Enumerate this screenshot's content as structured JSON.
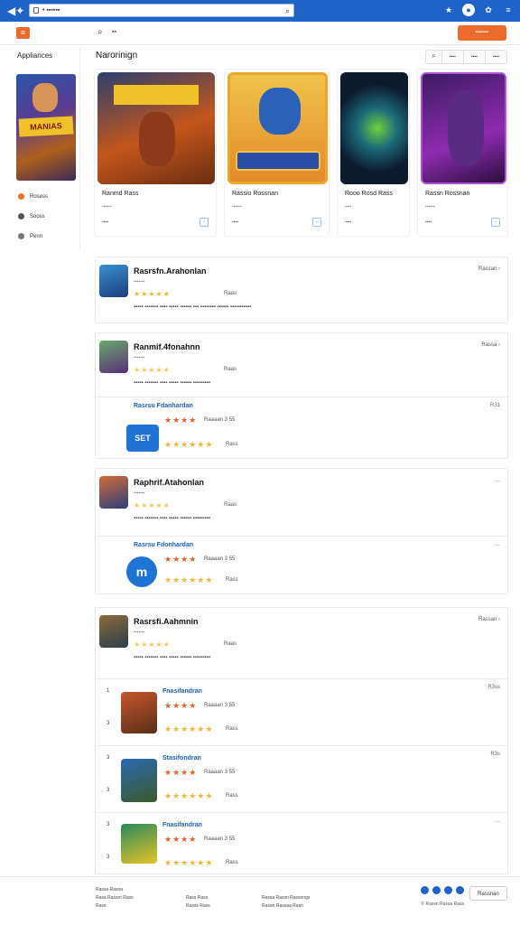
{
  "browser": {
    "address": "• ▪▪▪▪▪▪"
  },
  "toolbar": {
    "search_text": "▪▪",
    "cta_label": "▪▪▪▪▪▪▪"
  },
  "sidebar": {
    "title": "Appliances",
    "banner_text": "MANIAS",
    "items": [
      {
        "label": "Rosess"
      },
      {
        "label": "Sooss"
      },
      {
        "label": "Penn"
      }
    ]
  },
  "main": {
    "heading": "Narorinign",
    "filters": [
      "⌕",
      "▪▪▪▪",
      "▪▪▪▪",
      "▪▪▪▪"
    ]
  },
  "featured": [
    {
      "name": "Ranmd Rass",
      "sub": "▪▪▪▪▪▪",
      "meta": "▪▪▪▪"
    },
    {
      "name": "Rassio Rossnan",
      "sub": "▪▪▪▪▪▪",
      "meta": "▪▪▪▪"
    },
    {
      "name": "Rooo Rosd Rass",
      "sub": "▪▪▪▪",
      "meta": "▪▪▪▪"
    },
    {
      "name": "Rassn Rossnan",
      "sub": "▪▪▪▪▪▪",
      "meta": "▪▪▪▪"
    }
  ],
  "sections": [
    {
      "title": "Rasrsfn.Arahonlan",
      "dev": "▪▪▪▪▪▪▪",
      "rating": "★★★★★",
      "reviews": "Raas",
      "desc": "▪▪▪▪▪ ▪▪▪▪▪▪▪ ▪▪▪▪ ▪▪▪▪▪ ▪▪▪▪▪▪ ▪▪▪ ▪▪▪▪▪▪▪▪ ▪▪▪▪▪▪ ▪▪▪▪▪▪▪▪▪▪▪",
      "more": "Rassan ›",
      "subs": []
    },
    {
      "title": "Ranmif.4fonahnn",
      "dev": "▪▪▪▪▪▪▪",
      "rating": "★★★★★",
      "reviews": "Raas",
      "desc": "▪▪▪▪▪ ▪▪▪▪▪▪▪ ▪▪▪▪ ▪▪▪▪▪ ▪▪▪▪▪▪ ▪▪▪▪▪▪▪▪▪",
      "more": "Rassa ›",
      "subs": [
        {
          "title": "Rasrsu Fdanhardan",
          "r1": "★★★★",
          "r1t": "Raaaan 3 55",
          "r2": "★★★★★★",
          "r2t": "Rass",
          "rank": "R31",
          "icon": "SET"
        }
      ]
    },
    {
      "title": "Raphrif.Atahonlan",
      "dev": "▪▪▪▪▪▪▪",
      "rating": "★★★★★",
      "reviews": "Raas",
      "desc": "▪▪▪▪▪ ▪▪▪▪▪▪▪ ▪▪▪▪ ▪▪▪▪▪ ▪▪▪▪▪▪ ▪▪▪▪▪▪▪▪▪",
      "more": "…",
      "subs": [
        {
          "title": "Rasrsu Fdonhardan",
          "r1": "★★★★",
          "r1t": "Raaaan 3 55",
          "r2": "★★★★★★",
          "r2t": "Rass",
          "rank": "…",
          "icon": "m"
        }
      ]
    },
    {
      "title": "Rasrsfi.Aahmnin",
      "dev": "▪▪▪▪▪▪▪",
      "rating": "★★★★★",
      "reviews": "Raas",
      "desc": "▪▪▪▪▪ ▪▪▪▪▪▪▪ ▪▪▪▪ ▪▪▪▪▪ ▪▪▪▪▪▪ ▪▪▪▪▪▪▪▪▪",
      "more": "Rassan ›",
      "subs": [
        {
          "idx": "1",
          "title": "Fnasifandran",
          "r1": "★★★★",
          "r1t": "Raaaan 3 55",
          "r2": "★★★★★★",
          "r2t": "Rass",
          "rank": "R3ss"
        },
        {
          "idx": "3",
          "title": "Stasifondran",
          "r1": "★★★★",
          "r1t": "Raaaan 3 55",
          "r2": "★★★★★★",
          "r2t": "Rass",
          "rank": "R3s"
        },
        {
          "idx": "3",
          "title": "Fnasifandran",
          "r1": "★★★★",
          "r1t": "Raaaan 3 55",
          "r2": "★★★★★★",
          "r2t": "Rass",
          "rank": "…"
        }
      ]
    }
  ],
  "footer": {
    "col1": [
      "Rassa Rasna",
      "Rasa Rassrn Rass",
      "Rass"
    ],
    "col2": [
      "Rass Rass",
      "Rasss Rass"
    ],
    "col3": [
      "Rassa Rassn Rassnngs",
      "Rasan Rassaa Rasn"
    ],
    "copyright": "© Rassn Rassa Rass",
    "button": "Rassnan"
  }
}
